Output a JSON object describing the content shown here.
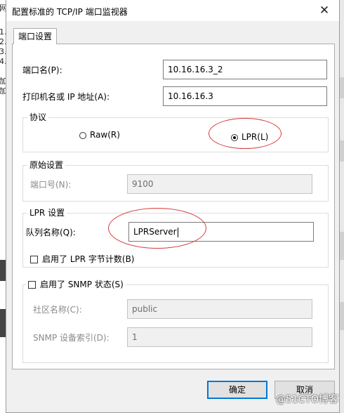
{
  "background": {
    "left_fragments": [
      "网",
      "1.",
      "2.",
      "3.",
      "4.",
      "加",
      "加"
    ]
  },
  "window": {
    "title": "配置标准的 TCP/IP 端口监视器"
  },
  "tab": {
    "label": "端口设置"
  },
  "port_name": {
    "label": "端口名(P):",
    "value": "10.16.16.3_2"
  },
  "printer_address": {
    "label": "打印机名或 IP 地址(A):",
    "value": "10.16.16.3"
  },
  "protocol": {
    "group_title": "协议",
    "raw_label": "Raw(R)",
    "lpr_label": "LPR(L)",
    "selected": "LPR"
  },
  "raw_settings": {
    "group_title": "原始设置",
    "port_number_label": "端口号(N):",
    "port_number_value": "9100"
  },
  "lpr_settings": {
    "group_title": "LPR 设置",
    "queue_name_label": "队列名称(Q):",
    "queue_name_value": "LPRServer",
    "byte_count_label": "启用了 LPR 字节计数(B)",
    "byte_count_checked": false
  },
  "snmp": {
    "enable_label": "启用了 SNMP 状态(S)",
    "enabled": false,
    "community_label": "社区名称(C):",
    "community_value": "public",
    "device_index_label": "SNMP 设备索引(D):",
    "device_index_value": "1"
  },
  "buttons": {
    "ok": "确定",
    "cancel": "取消"
  },
  "watermark": "@51CTO博客",
  "colors": {
    "annotation": "#d63a3a",
    "focus": "#0078d7"
  }
}
